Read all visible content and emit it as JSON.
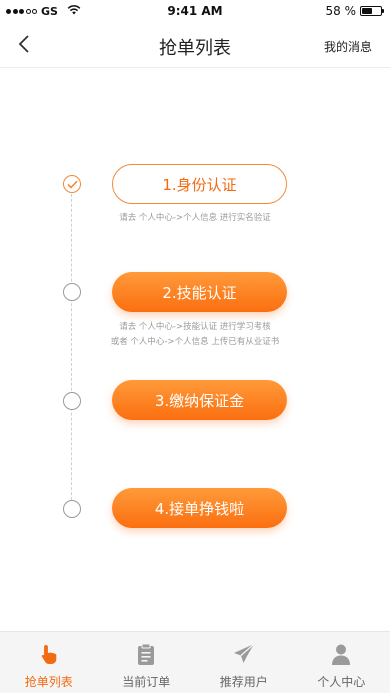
{
  "status_bar": {
    "carrier": "GS",
    "time": "9:41 AM",
    "battery_text": "58 %",
    "battery_level": 0.58
  },
  "nav": {
    "title": "抢单列表",
    "right_label": "我的消息"
  },
  "steps": [
    {
      "label": "1.身份认证",
      "state": "done",
      "hint_lines": [
        "请去 个人中心->个人信息 进行实名验证"
      ]
    },
    {
      "label": "2.技能认证",
      "state": "todo",
      "hint_lines": [
        "请去 个人中心->技能认证 进行学习考核",
        "或者 个人中心->个人信息 上传已有从业证书"
      ]
    },
    {
      "label": "3.缴纳保证金",
      "state": "todo",
      "hint_lines": []
    },
    {
      "label": "4.接单挣钱啦",
      "state": "todo",
      "hint_lines": []
    }
  ],
  "tabs": [
    {
      "label": "抢单列表",
      "icon": "hand-tap-icon",
      "active": true
    },
    {
      "label": "当前订单",
      "icon": "clipboard-icon",
      "active": false
    },
    {
      "label": "推荐用户",
      "icon": "paper-plane-icon",
      "active": false
    },
    {
      "label": "个人中心",
      "icon": "user-icon",
      "active": false
    }
  ],
  "colors": {
    "accent": "#f26b12",
    "accent_light": "#ff9a3a",
    "inactive_icon": "#999999"
  }
}
